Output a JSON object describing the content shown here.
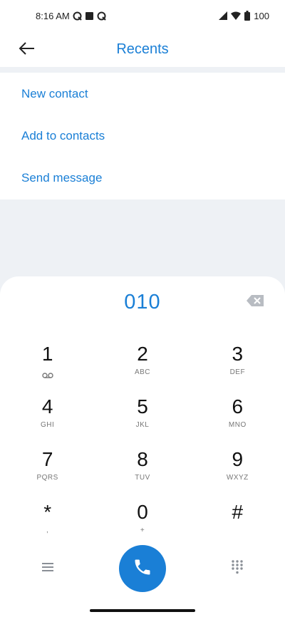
{
  "status_bar": {
    "time": "8:16 AM",
    "battery": "100"
  },
  "header": {
    "title": "Recents"
  },
  "menu": {
    "items": [
      {
        "label": "New contact"
      },
      {
        "label": "Add to contacts"
      },
      {
        "label": "Send message"
      }
    ]
  },
  "dialpad": {
    "number": "010",
    "keys": [
      {
        "digit": "1",
        "letters": ""
      },
      {
        "digit": "2",
        "letters": "ABC"
      },
      {
        "digit": "3",
        "letters": "DEF"
      },
      {
        "digit": "4",
        "letters": "GHI"
      },
      {
        "digit": "5",
        "letters": "JKL"
      },
      {
        "digit": "6",
        "letters": "MNO"
      },
      {
        "digit": "7",
        "letters": "PQRS"
      },
      {
        "digit": "8",
        "letters": "TUV"
      },
      {
        "digit": "9",
        "letters": "WXYZ"
      },
      {
        "digit": "*",
        "letters": ","
      },
      {
        "digit": "0",
        "letters": "+"
      },
      {
        "digit": "#",
        "letters": ""
      }
    ]
  },
  "colors": {
    "accent": "#1a7fd6",
    "background": "#eef1f5",
    "surface": "#ffffff"
  },
  "icons": {
    "back": "back-arrow-icon",
    "backspace": "backspace-icon",
    "voicemail": "voicemail-icon",
    "menu": "menu-icon",
    "call": "phone-call-icon",
    "keypad": "keypad-icon"
  }
}
